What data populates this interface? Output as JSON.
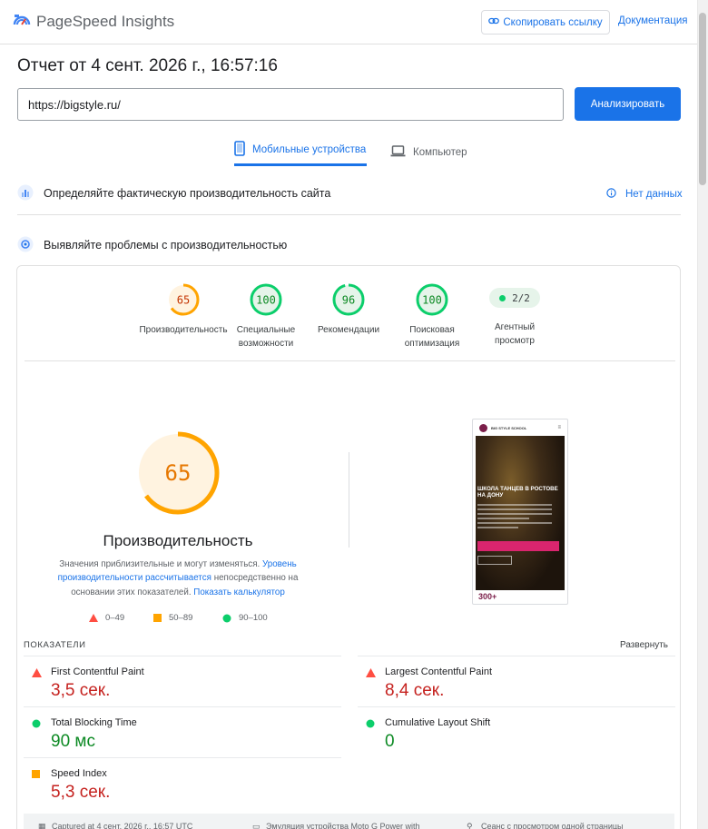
{
  "header": {
    "app_title": "PageSpeed Insights",
    "copy_link_label": "Скопировать ссылку",
    "docs_label": "Документация"
  },
  "report": {
    "title": "Отчет от 4 сент. 2026 г., 16:57:16",
    "url_value": "https://bigstyle.ru/",
    "analyze_label": "Анализировать"
  },
  "tabs": [
    {
      "label": "Мобильные устройства",
      "active": true,
      "icon": "smartphone-icon"
    },
    {
      "label": "Компьютер",
      "active": false,
      "icon": "laptop-icon"
    }
  ],
  "field_data": {
    "heading": "Определяйте фактическую производительность сайта",
    "status": "Нет данных"
  },
  "lab": {
    "heading": "Выявляйте проблемы с производительностью"
  },
  "scores": [
    {
      "value": "65",
      "label_1": "Производительность",
      "label_2": "",
      "color": "#e67700",
      "fill": 0.65
    },
    {
      "value": "100",
      "label_1": "Специальные",
      "label_2": "возможности",
      "color": "#0cce6b",
      "fill": 1.0
    },
    {
      "value": "96",
      "label_1": "Рекомендации",
      "label_2": "",
      "color": "#0cce6b",
      "fill": 0.96
    },
    {
      "value": "100",
      "label_1": "Поисковая",
      "label_2": "оптимизация",
      "color": "#0cce6b",
      "fill": 1.0
    }
  ],
  "pwa": {
    "value": "2/2",
    "label_1": "Агентный",
    "label_2": "просмотр"
  },
  "performance": {
    "score": "65",
    "fill": 0.65,
    "title": "Производительность",
    "note_1": "Значения приблизительные и могут изменяться.",
    "note_link": "Уровень производительности рассчитывается",
    "note_2": "непосредственно на основании этих показателей.",
    "calc_link": "Показать калькулятор"
  },
  "legend": [
    {
      "range": "0–49",
      "shape": "triangle",
      "color": "#ff4e42"
    },
    {
      "range": "50–89",
      "shape": "square",
      "color": "#ffa400"
    },
    {
      "range": "90–100",
      "shape": "circle",
      "color": "#0cce6b"
    }
  ],
  "screenshot": {
    "site_name": "BIG STYLE SCHOOL",
    "heading": "ШКОЛА ТАНЦЕВ В РОСТОВЕ НА ДОНУ",
    "counter": "300+"
  },
  "metrics": {
    "label": "ПОКАЗАТЕЛИ",
    "expand": "Развернуть",
    "items": [
      {
        "name": "First Contentful Paint",
        "value": "3,5 сек.",
        "rating": "fail"
      },
      {
        "name": "Largest Contentful Paint",
        "value": "8,4 сек.",
        "rating": "fail"
      },
      {
        "name": "Total Blocking Time",
        "value": "90 мс",
        "rating": "pass"
      },
      {
        "name": "Cumulative Layout Shift",
        "value": "0",
        "rating": "pass"
      },
      {
        "name": "Speed Index",
        "value": "5,3 сек.",
        "rating": "average"
      }
    ]
  },
  "footer": {
    "captured": "Captured at 4 сент. 2026 г., 16:57 UTC",
    "emulation": "Эмуляция устройства Moto G Power with",
    "session": "Сеанс с просмотром одной страницы"
  },
  "colors": {
    "accent": "#1a73e8",
    "fail": "#c5221f",
    "pass": "#0d8a24",
    "average_gauge": "#ffa400"
  }
}
